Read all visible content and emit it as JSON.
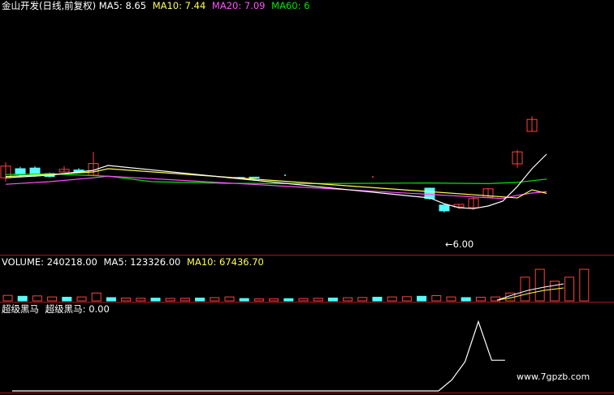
{
  "main_header": {
    "title": "金山开发(日线,前复权)",
    "ma5_label": "MA5:",
    "ma5_value": "8.65",
    "ma10_label": "MA10:",
    "ma10_value": "7.44",
    "ma20_label": "MA20:",
    "ma20_value": "7.09",
    "ma60_label": "MA60:",
    "ma60_value": "6"
  },
  "volume_header": {
    "label": "VOLUME:",
    "value": "240218.00",
    "ma5_label": "MA5:",
    "ma5_value": "123326.00",
    "ma10_label": "MA10:",
    "ma10_value": "67436.70"
  },
  "indicator_header": {
    "name": "超级黑马",
    "value_label": "超级黑马:",
    "value": "0.00"
  },
  "low_marker": "←6.00",
  "watermark": "www.7gpzb.com",
  "colors": {
    "up": "#ff4040",
    "down": "#54ffff",
    "ma5": "#ffffff",
    "ma10": "#ffff4e",
    "ma20": "#ff50ff",
    "ma60": "#00e600",
    "divider": "#a01818",
    "indicator": "#ffffff"
  },
  "chart_data": [
    {
      "type": "candlestick",
      "panel": "price",
      "days": 34,
      "candles": [
        {
          "day": 0,
          "open": 7.92,
          "close": 8.28,
          "high": 8.4,
          "low": 7.8
        },
        {
          "day": 1,
          "open": 8.2,
          "close": 8.02,
          "high": 8.26,
          "low": 7.96
        },
        {
          "day": 2,
          "open": 8.22,
          "close": 8.0,
          "high": 8.28,
          "low": 7.95
        },
        {
          "day": 3,
          "open": 8.05,
          "close": 7.96,
          "high": 8.08,
          "low": 7.93
        },
        {
          "day": 4,
          "open": 8.1,
          "close": 8.18,
          "high": 8.28,
          "low": 8.08
        },
        {
          "day": 5,
          "open": 8.16,
          "close": 8.1,
          "high": 8.22,
          "low": 8.07
        },
        {
          "day": 6,
          "open": 8.0,
          "close": 8.36,
          "high": 8.72,
          "low": 7.98
        },
        {
          "day": 16,
          "open": 7.93,
          "close": 7.91,
          "high": 7.95,
          "low": 7.89
        },
        {
          "day": 17,
          "open": 7.94,
          "close": 7.93,
          "high": 7.95,
          "low": 7.92
        },
        {
          "day": 29,
          "open": 7.6,
          "close": 7.28,
          "high": 7.62,
          "low": 7.24
        },
        {
          "day": 30,
          "open": 7.08,
          "close": 6.9,
          "high": 7.12,
          "low": 6.85
        },
        {
          "day": 31,
          "open": 7.02,
          "close": 7.1,
          "high": 7.12,
          "low": 6.96
        },
        {
          "day": 32,
          "open": 7.0,
          "close": 7.28,
          "high": 7.32,
          "low": 6.93
        },
        {
          "day": 33,
          "open": 7.32,
          "close": 7.58,
          "high": 7.6,
          "low": 7.3
        },
        {
          "day": 35,
          "open": 8.35,
          "close": 8.72,
          "high": 8.78,
          "low": 8.22
        },
        {
          "day": 36,
          "open": 9.35,
          "close": 9.72,
          "high": 9.82,
          "low": 9.34
        }
      ],
      "ma5": [
        [
          0,
          7.92
        ],
        [
          3,
          8.0
        ],
        [
          6,
          8.15
        ],
        [
          7,
          8.3
        ],
        [
          29,
          7.3
        ],
        [
          30,
          7.12
        ],
        [
          31,
          7.0
        ],
        [
          32,
          6.97
        ],
        [
          33,
          7.05
        ],
        [
          34,
          7.2
        ],
        [
          35,
          7.65
        ],
        [
          36,
          8.2
        ],
        [
          37,
          8.65
        ]
      ],
      "ma10": [
        [
          0,
          7.96
        ],
        [
          3,
          8.02
        ],
        [
          6,
          8.1
        ],
        [
          7,
          8.2
        ],
        [
          35,
          7.3
        ],
        [
          36,
          7.55
        ],
        [
          37,
          7.44
        ]
      ],
      "ma20": [
        [
          0,
          7.72
        ],
        [
          3,
          7.8
        ],
        [
          6,
          7.92
        ],
        [
          7,
          7.97
        ],
        [
          34,
          7.28
        ],
        [
          35,
          7.38
        ],
        [
          36,
          7.45
        ],
        [
          37,
          7.49
        ]
      ],
      "ma60": [
        [
          0,
          8.02
        ],
        [
          3,
          8.04
        ],
        [
          7,
          7.97
        ],
        [
          10,
          7.8
        ],
        [
          15,
          7.75
        ],
        [
          20,
          7.74
        ],
        [
          25,
          7.75
        ],
        [
          29,
          7.76
        ],
        [
          33,
          7.74
        ],
        [
          35,
          7.78
        ],
        [
          37,
          7.88
        ]
      ],
      "low_annotation": {
        "day": 30,
        "price": 6.0
      }
    },
    {
      "type": "bar",
      "panel": "volume",
      "values": [
        42000,
        35000,
        38000,
        30000,
        28000,
        30000,
        60000,
        25000,
        22000,
        20000,
        21000,
        19000,
        20000,
        22000,
        25000,
        30000,
        18000,
        15000,
        16000,
        17000,
        18000,
        20000,
        22000,
        24000,
        26000,
        28000,
        30000,
        32000,
        35000,
        40000,
        30000,
        25000,
        28000,
        30000,
        60000,
        180000,
        240218,
        150000,
        180000,
        240218
      ]
    },
    {
      "type": "line",
      "panel": "indicator",
      "name": "超级黑马",
      "values": [
        [
          0,
          0
        ],
        [
          32,
          0
        ],
        [
          33,
          0.15
        ],
        [
          34,
          0.4
        ],
        [
          35,
          0.95
        ],
        [
          36,
          0.42
        ],
        [
          37,
          0.42
        ]
      ]
    }
  ]
}
